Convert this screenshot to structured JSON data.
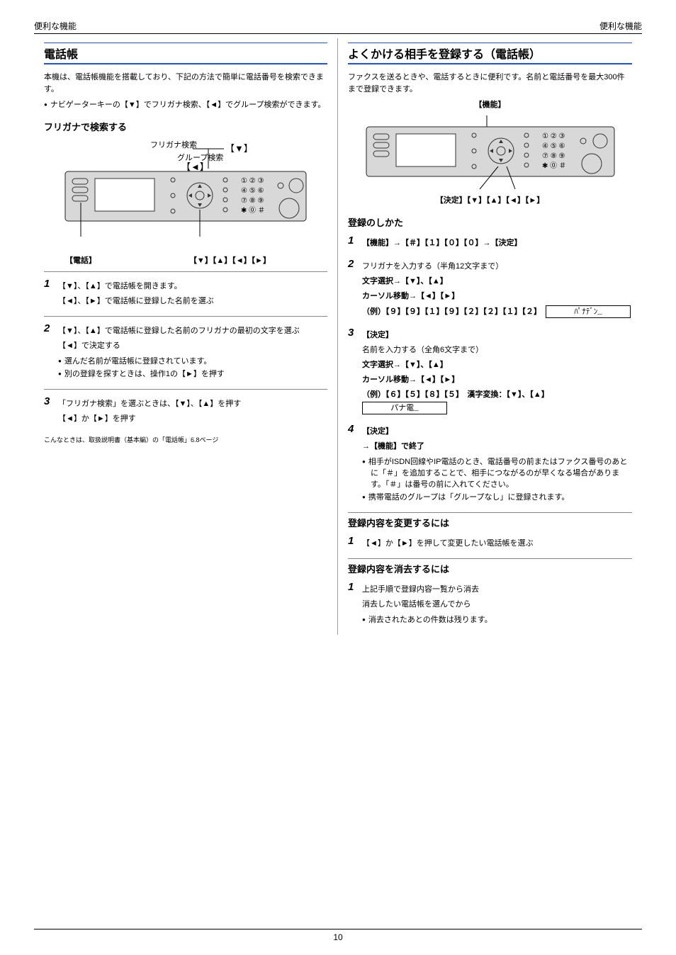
{
  "header": {
    "tab_left": "便利な機能",
    "tab_right": "便利な機能"
  },
  "left": {
    "title": "電話帳",
    "intro": "本機は、電話帳機能を搭載しており、下記の方法で簡単に電話番号を検索できます。",
    "bullets_intro": [
      "ナビゲーターキーの【▼】でフリガナ検索、【◄】でグループ検索ができます。"
    ],
    "sub_kana": "フリガナで検索する",
    "panel": {
      "label_tel": "【電話】",
      "label_nav": "【▼】【▲】【◄】【►】"
    },
    "step1": {
      "line1": "【▼】、【▲】で電話帳を開きます。",
      "line2": "【◄】、【►】で電話帳に登録した名前を選ぶ"
    },
    "step2": {
      "line1": "【▼】、【▲】で電話帳に登録した名前のフリガナの最初の文字を選ぶ",
      "line2": "【◄】で決定する",
      "sub_bullets": [
        "選んだ名前が電話帳に登録されています。",
        "別の登録を探すときは、操作1の【►】を押す"
      ]
    },
    "step3": {
      "line1": "「フリガナ検索」を選ぶときは、【▼】、【▲】を押す",
      "line2": "【◄】か【►】を押す"
    },
    "refnote": "こんなときは、取扱説明書（基本編）の「電話帳」6.8ページ"
  },
  "right": {
    "title": "よくかける相手を登録する（電話帳）",
    "intro": "ファクスを送るときや、電話するときに便利です。名前と電話番号を最大300件まで登録できます。",
    "panel": {
      "label_kinou": "【機能】",
      "label_nav": "【決定】【▼】【▲】【◄】【►】"
    },
    "sub_prog": "登録のしかた",
    "step1_prog": "【機能】→【＃】【１】【０】【０】→【決定】",
    "step2_prog": {
      "l1": "フリガナを入力する（半角12文字まで）",
      "l2a": "文字選択→【▼】、【▲】",
      "l2b": "カーソル移動→【◄】【►】",
      "l3": "（例）【９】【９】【１】【９】【２】【２】【１】【２】",
      "lcd": "ﾊﾟﾅﾃﾞﾝ_"
    },
    "step3_prog": {
      "l0": "【決定】",
      "l1": "名前を入力する（全角6文字まで）",
      "l2a": "文字選択→【▼】、【▲】",
      "l2b": "カーソル移動→【◄】【►】",
      "l3": "（例）【６】【５】【８】【５】　漢字変換：【▼】、【▲】",
      "lcd": "パナ電_"
    },
    "step4_prog": {
      "l0": "【決定】",
      "l1": "→【機能】で終了",
      "note1_bullet1": "相手がISDN回線やIP電話のとき、電話番号の前またはファクス番号のあとに「＃」を追加することで、相手につながるのが早くなる場合があります。「＃」は番号の前に入れてください。",
      "note1_bullet2": "携帯電話のグループは「グループなし」に登録されます。"
    },
    "sub_change": "登録内容を変更するには",
    "step1_change": "【◄】か【►】を押して変更したい電話帳を選ぶ",
    "sub_delete": "登録内容を消去するには",
    "step1_delete": {
      "l1": "上記手順で登録内容一覧から消去",
      "l2": "消去したい電話帳を選んでから",
      "bullet": "消去されたあとの件数は残ります。"
    }
  },
  "footer": {
    "pagenum": "10"
  }
}
